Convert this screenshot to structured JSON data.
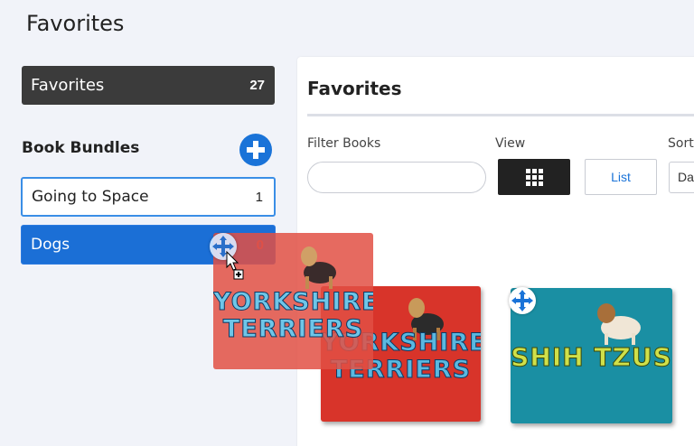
{
  "header": {
    "title": "Favorites"
  },
  "sidebar": {
    "favorites": {
      "label": "Favorites",
      "count": "27"
    },
    "bundles_heading": "Book Bundles",
    "bundles": [
      {
        "label": "Going to Space",
        "count": "1"
      },
      {
        "label": "Dogs",
        "count": "0"
      }
    ]
  },
  "main": {
    "title": "Favorites",
    "filter": {
      "label": "Filter Books",
      "placeholder": "",
      "value": ""
    },
    "view": {
      "label": "View",
      "list_label": "List"
    },
    "sort": {
      "label": "Sort",
      "value": "Da"
    }
  },
  "books": [
    {
      "title": "YORKSHIRE TERRIERS"
    },
    {
      "title": "SHIH TZUS"
    }
  ],
  "drag": {
    "title": "YORKSHIRE TERRIERS"
  },
  "icons": {
    "add": "plus-circle-icon",
    "grid": "grid-icon",
    "move": "move-arrows-icon",
    "cursor": "cursor-copy-icon"
  },
  "colors": {
    "accent": "#1a73d8",
    "dark": "#3b3b3b",
    "selected": "#1b6fd6"
  }
}
